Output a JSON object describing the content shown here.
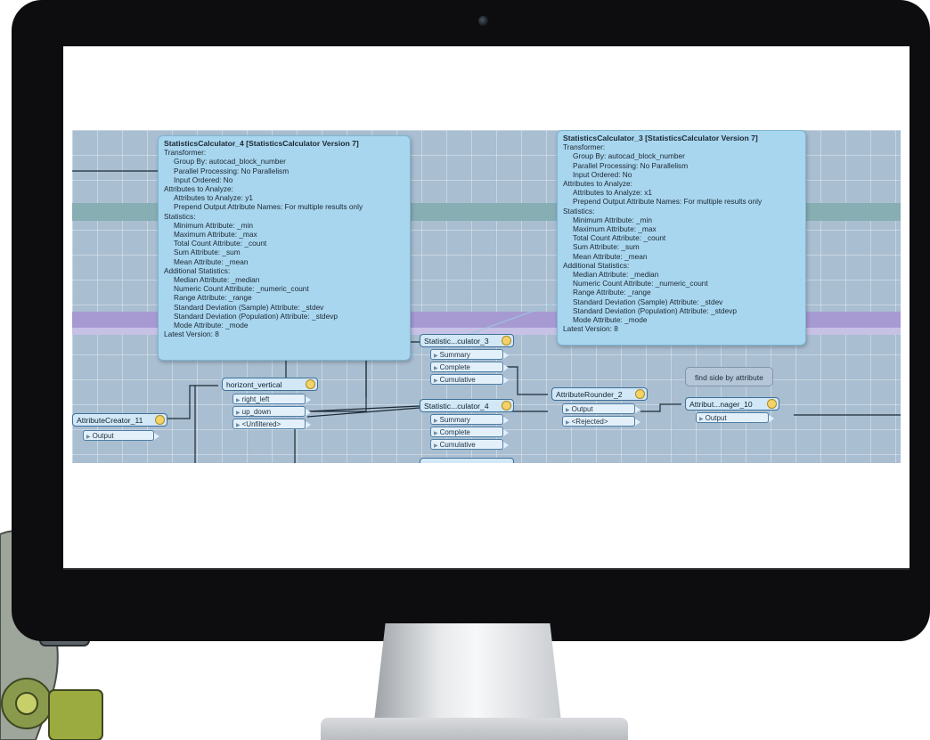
{
  "tooltip_4": {
    "title": "StatisticsCalculator_4 [StatisticsCalculator Version 7]",
    "lines": [
      {
        "text": "Transformer:",
        "indent": 0
      },
      {
        "text": "Group By: autocad_block_number",
        "indent": 1
      },
      {
        "text": "Parallel Processing: No Parallelism",
        "indent": 1
      },
      {
        "text": "Input Ordered: No",
        "indent": 1
      },
      {
        "text": "Attributes to Analyze:",
        "indent": 0
      },
      {
        "text": "Attributes to Analyze: y1",
        "indent": 1
      },
      {
        "text": "Prepend Output Attribute Names: For multiple results only",
        "indent": 1
      },
      {
        "text": "Statistics:",
        "indent": 0
      },
      {
        "text": "Minimum Attribute: _min",
        "indent": 1
      },
      {
        "text": "Maximum Attribute: _max",
        "indent": 1
      },
      {
        "text": "Total Count Attribute: _count",
        "indent": 1
      },
      {
        "text": "Sum Attribute: _sum",
        "indent": 1
      },
      {
        "text": "Mean Attribute: _mean",
        "indent": 1
      },
      {
        "text": "Additional Statistics:",
        "indent": 0
      },
      {
        "text": "Median Attribute: _median",
        "indent": 1
      },
      {
        "text": "Numeric Count Attribute: _numeric_count",
        "indent": 1
      },
      {
        "text": "Range Attribute: _range",
        "indent": 1
      },
      {
        "text": "Standard Deviation (Sample) Attribute: _stdev",
        "indent": 1
      },
      {
        "text": "Standard Deviation (Population) Attribute: _stdevp",
        "indent": 1
      },
      {
        "text": "Mode Attribute: _mode",
        "indent": 1
      },
      {
        "text": "Latest Version: 8",
        "indent": 0
      }
    ]
  },
  "tooltip_3": {
    "title": "StatisticsCalculator_3 [StatisticsCalculator Version 7]",
    "lines": [
      {
        "text": "Transformer:",
        "indent": 0
      },
      {
        "text": "Group By: autocad_block_number",
        "indent": 1
      },
      {
        "text": "Parallel Processing: No Parallelism",
        "indent": 1
      },
      {
        "text": "Input Ordered: No",
        "indent": 1
      },
      {
        "text": "Attributes to Analyze:",
        "indent": 0
      },
      {
        "text": "Attributes to Analyze: x1",
        "indent": 1
      },
      {
        "text": "Prepend Output Attribute Names: For multiple results only",
        "indent": 1
      },
      {
        "text": "Statistics:",
        "indent": 0
      },
      {
        "text": "Minimum Attribute: _min",
        "indent": 1
      },
      {
        "text": "Maximum Attribute: _max",
        "indent": 1
      },
      {
        "text": "Total Count Attribute: _count",
        "indent": 1
      },
      {
        "text": "Sum Attribute: _sum",
        "indent": 1
      },
      {
        "text": "Mean Attribute: _mean",
        "indent": 1
      },
      {
        "text": "Additional Statistics:",
        "indent": 0
      },
      {
        "text": "Median Attribute: _median",
        "indent": 1
      },
      {
        "text": "Numeric Count Attribute: _numeric_count",
        "indent": 1
      },
      {
        "text": "Range Attribute: _range",
        "indent": 1
      },
      {
        "text": "Standard Deviation (Sample) Attribute: _stdev",
        "indent": 1
      },
      {
        "text": "Standard Deviation (Population) Attribute: _stdevp",
        "indent": 1
      },
      {
        "text": "Mode Attribute: _mode",
        "indent": 1
      },
      {
        "text": "Latest Version: 8",
        "indent": 0
      }
    ]
  },
  "transformers": {
    "attribute_creator": {
      "label": "AttributeCreator_11",
      "ports": [
        "Output"
      ]
    },
    "horizont_vertical": {
      "label": "horizont_vertical",
      "ports": [
        "right_left",
        "up_down",
        "<Unfiltered>"
      ]
    },
    "stat_calc_3": {
      "label": "Statistic...culator_3",
      "ports": [
        "Summary",
        "Complete",
        "Cumulative"
      ]
    },
    "stat_calc_4": {
      "label": "Statistic...culator_4",
      "ports": [
        "Summary",
        "Complete",
        "Cumulative"
      ]
    },
    "attribute_rounder": {
      "label": "AttributeRounder_2",
      "ports": [
        "Output",
        "<Rejected>"
      ]
    },
    "attribute_manager": {
      "label": "Attribut...nager_10",
      "ports": [
        "Output"
      ]
    }
  },
  "annotation": {
    "text": "find side by attribute"
  },
  "colors": {
    "canvas": "#a9bed1",
    "tooltip": "#a8d6ee",
    "transformer": "#d2e8f7",
    "band_teal": "#86aeb3",
    "band_purple": "#a79ad3"
  }
}
